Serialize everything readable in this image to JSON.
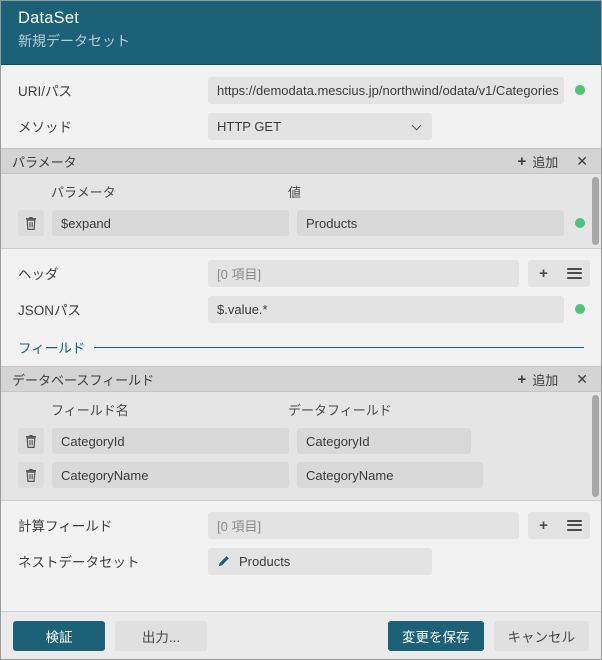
{
  "header": {
    "title": "DataSet",
    "subtitle": "新規データセット"
  },
  "uri": {
    "label": "URI/パス",
    "value": "https://demodata.mescius.jp/northwind/odata/v1/Categories",
    "status": "ok"
  },
  "method": {
    "label": "メソッド",
    "value": "HTTP GET",
    "chevron_icon": "chevron-down-icon"
  },
  "parameters_panel": {
    "title": "パラメータ",
    "add_label": "追加",
    "add_icon": "plus-icon",
    "close_icon": "close-icon",
    "columns": [
      "パラメータ",
      "値"
    ],
    "rows": [
      {
        "name": "$expand",
        "value": "Products",
        "status": "ok",
        "delete_icon": "trash-icon"
      }
    ]
  },
  "headers_row": {
    "label": "ヘッダ",
    "value": "[0 項目]",
    "add_icon": "plus-icon",
    "menu_icon": "hamburger-icon"
  },
  "json_path": {
    "label": "JSONパス",
    "value": "$.value.*",
    "status": "ok"
  },
  "fields_section": {
    "label": "フィールド"
  },
  "db_fields_panel": {
    "title": "データベースフィールド",
    "add_label": "追加",
    "add_icon": "plus-icon",
    "close_icon": "close-icon",
    "columns": [
      "フィールド名",
      "データフィールド"
    ],
    "rows": [
      {
        "name": "CategoryId",
        "data_field": "CategoryId",
        "delete_icon": "trash-icon"
      },
      {
        "name": "CategoryName",
        "data_field": "CategoryName",
        "delete_icon": "trash-icon"
      }
    ]
  },
  "calc_fields_row": {
    "label": "計算フィールド",
    "value": "[0 項目]",
    "add_icon": "plus-icon",
    "menu_icon": "hamburger-icon"
  },
  "nested_dataset_row": {
    "label": "ネストデータセット",
    "value": "Products",
    "edit_icon": "pencil-icon"
  },
  "footer": {
    "validate": "検証",
    "output": "出力...",
    "save": "変更を保存",
    "cancel": "キャンセル"
  },
  "colors": {
    "accent": "#1b6279",
    "status_ok": "#4ec476",
    "panel_header": "#d4d4d4"
  }
}
